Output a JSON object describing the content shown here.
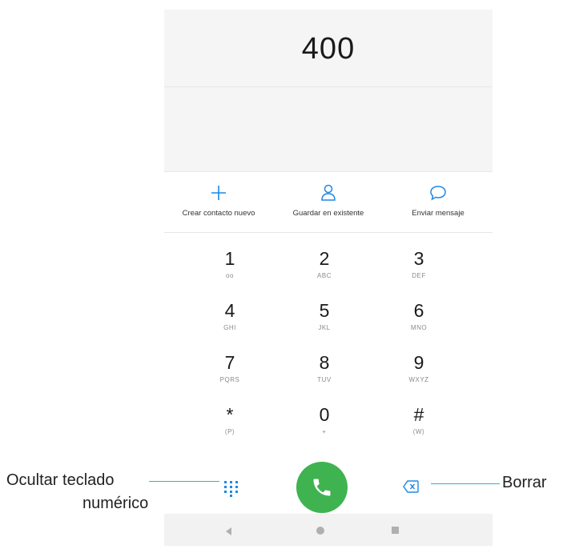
{
  "dialer": {
    "number": "400",
    "actions": [
      {
        "label": "Crear contacto nuevo",
        "icon": "plus-icon"
      },
      {
        "label": "Guardar en existente",
        "icon": "person-icon"
      },
      {
        "label": "Enviar mensaje",
        "icon": "message-bubble-icon"
      }
    ],
    "keys": [
      {
        "digit": "1",
        "letters": "oo"
      },
      {
        "digit": "2",
        "letters": "ABC"
      },
      {
        "digit": "3",
        "letters": "DEF"
      },
      {
        "digit": "4",
        "letters": "GHI"
      },
      {
        "digit": "5",
        "letters": "JKL"
      },
      {
        "digit": "6",
        "letters": "MNO"
      },
      {
        "digit": "7",
        "letters": "PQRS"
      },
      {
        "digit": "8",
        "letters": "TUV"
      },
      {
        "digit": "9",
        "letters": "WXYZ"
      },
      {
        "digit": "*",
        "letters": "(P)"
      },
      {
        "digit": "0",
        "letters": "+"
      },
      {
        "digit": "#",
        "letters": "(W)"
      }
    ],
    "call_button_icon": "phone-icon",
    "dialpad_toggle_icon": "dialpad-icon",
    "backspace_icon": "backspace-icon"
  },
  "callouts": {
    "left_line1": "Ocultar teclado",
    "left_line2": "numérico",
    "right": "Borrar",
    "line_color": "#2bb5c3"
  },
  "colors": {
    "accent": "#1e88e5",
    "call_green": "#3fb34f"
  }
}
